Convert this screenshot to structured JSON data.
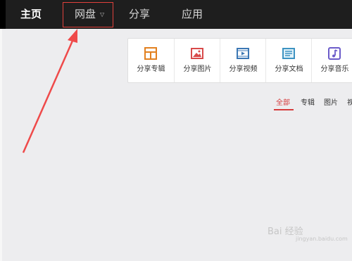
{
  "nav": {
    "home": "主页",
    "disk": "网盘",
    "share": "分享",
    "app": "应用"
  },
  "share_tools": [
    {
      "label": "分享专辑",
      "icon": "album-icon",
      "color": "#e2801f"
    },
    {
      "label": "分享图片",
      "icon": "image-icon",
      "color": "#d84a4a"
    },
    {
      "label": "分享视频",
      "icon": "video-icon",
      "color": "#3b77b4"
    },
    {
      "label": "分享文档",
      "icon": "document-icon",
      "color": "#3d93c2"
    },
    {
      "label": "分享音乐",
      "icon": "music-icon",
      "color": "#6b5bc9"
    }
  ],
  "filter_tabs": {
    "all": "全部",
    "album": "专辑",
    "image": "图片",
    "video_partial": "视"
  },
  "watermark": {
    "main": "Bai 经验",
    "sub": "jingyan.baidu.com"
  },
  "colors": {
    "accent": "#d63c3c",
    "topbar": "#1e1e1e",
    "annotation": "#e0413c"
  }
}
